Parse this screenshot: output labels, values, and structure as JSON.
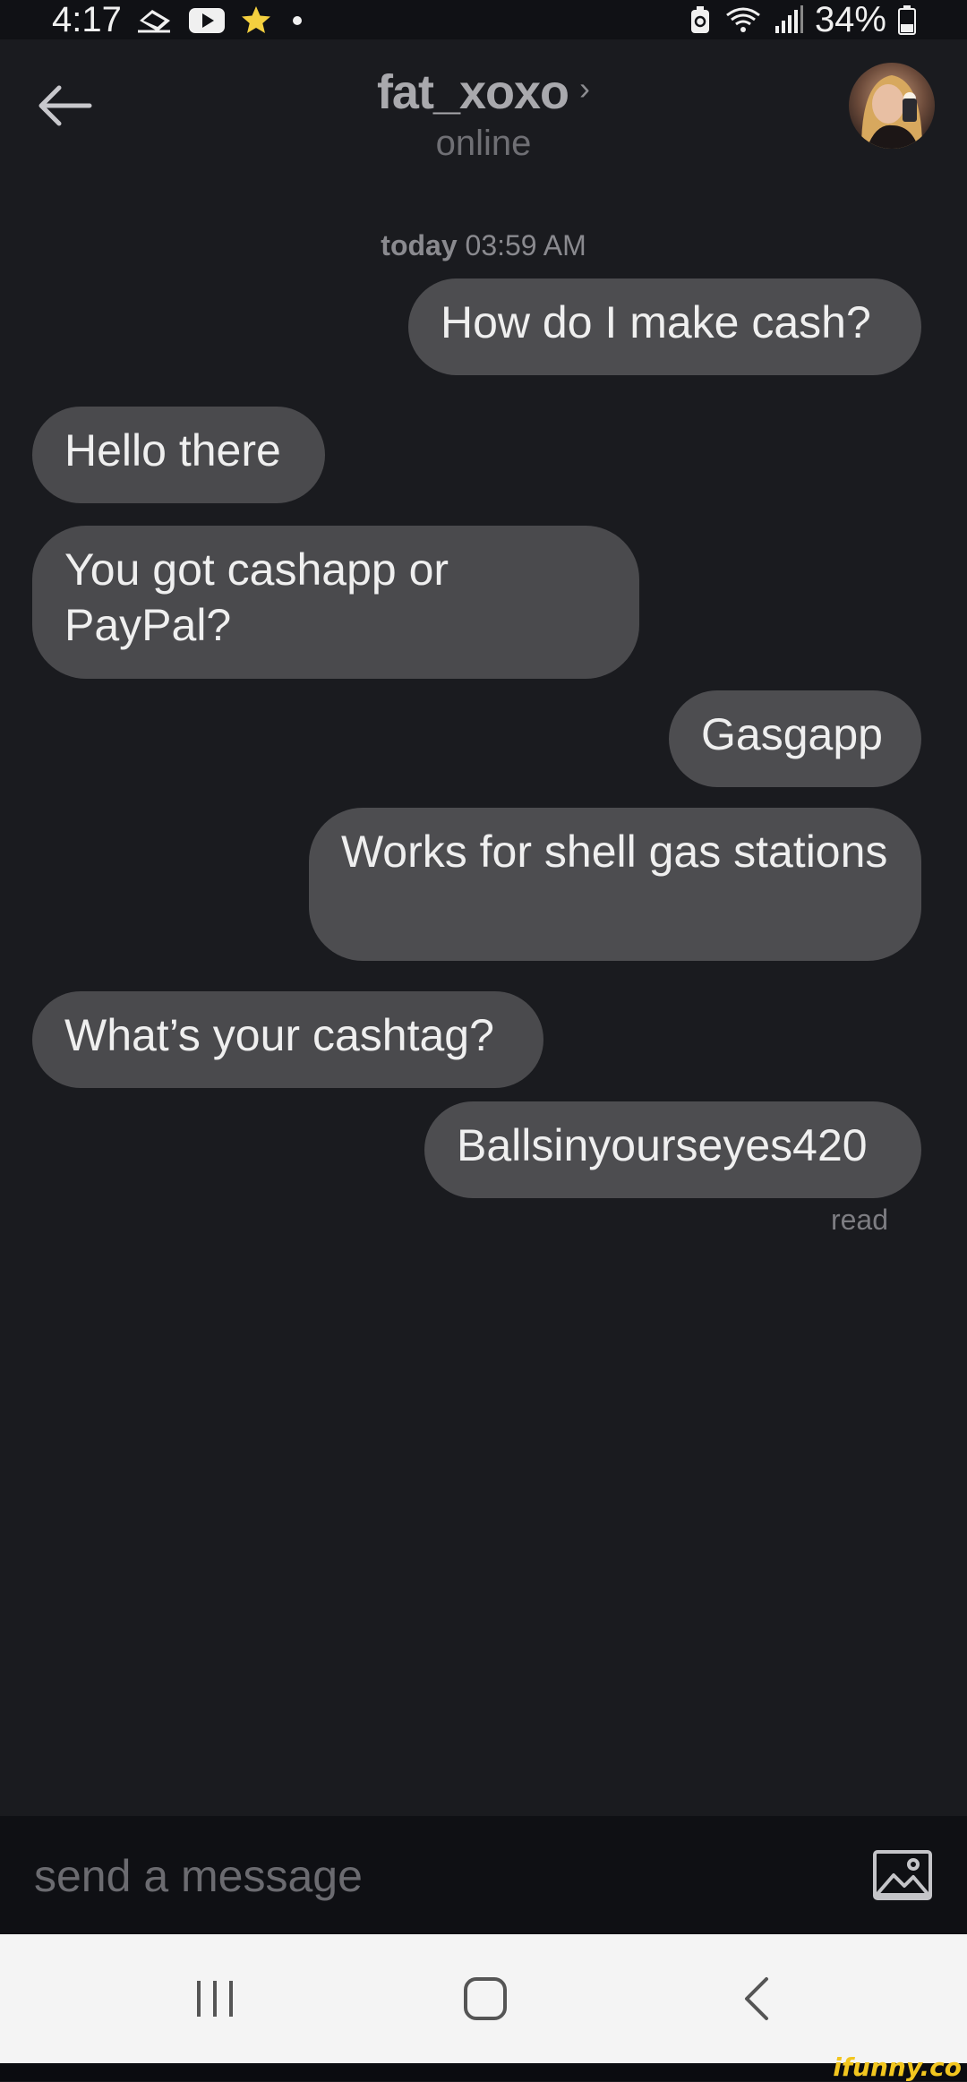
{
  "status_bar": {
    "time": "4:17",
    "battery": "34%"
  },
  "header": {
    "contact_name": "fat_xoxo",
    "contact_status": "online"
  },
  "conversation": {
    "timestamp_day": "today",
    "timestamp_time": "03:59 AM",
    "messages": [
      {
        "direction": "sent",
        "text": "How do I make cash?"
      },
      {
        "direction": "received",
        "text": "Hello there"
      },
      {
        "direction": "received",
        "text": "You got cashapp or PayPal?"
      },
      {
        "direction": "sent",
        "text": "Gasgapp"
      },
      {
        "direction": "sent",
        "text": "Works for shell gas stations"
      },
      {
        "direction": "received",
        "text": "What’s your cashtag?"
      },
      {
        "direction": "sent",
        "text": "Ballsinyourseyes420"
      }
    ],
    "read_receipt": "read"
  },
  "composer": {
    "placeholder": "send a message"
  },
  "watermark": "ifunny.co",
  "colors": {
    "background": "#1a1b1f",
    "bubble": "#4c4c4f",
    "composer": "#0f1014",
    "nav_bar": "#f4f4f4"
  }
}
